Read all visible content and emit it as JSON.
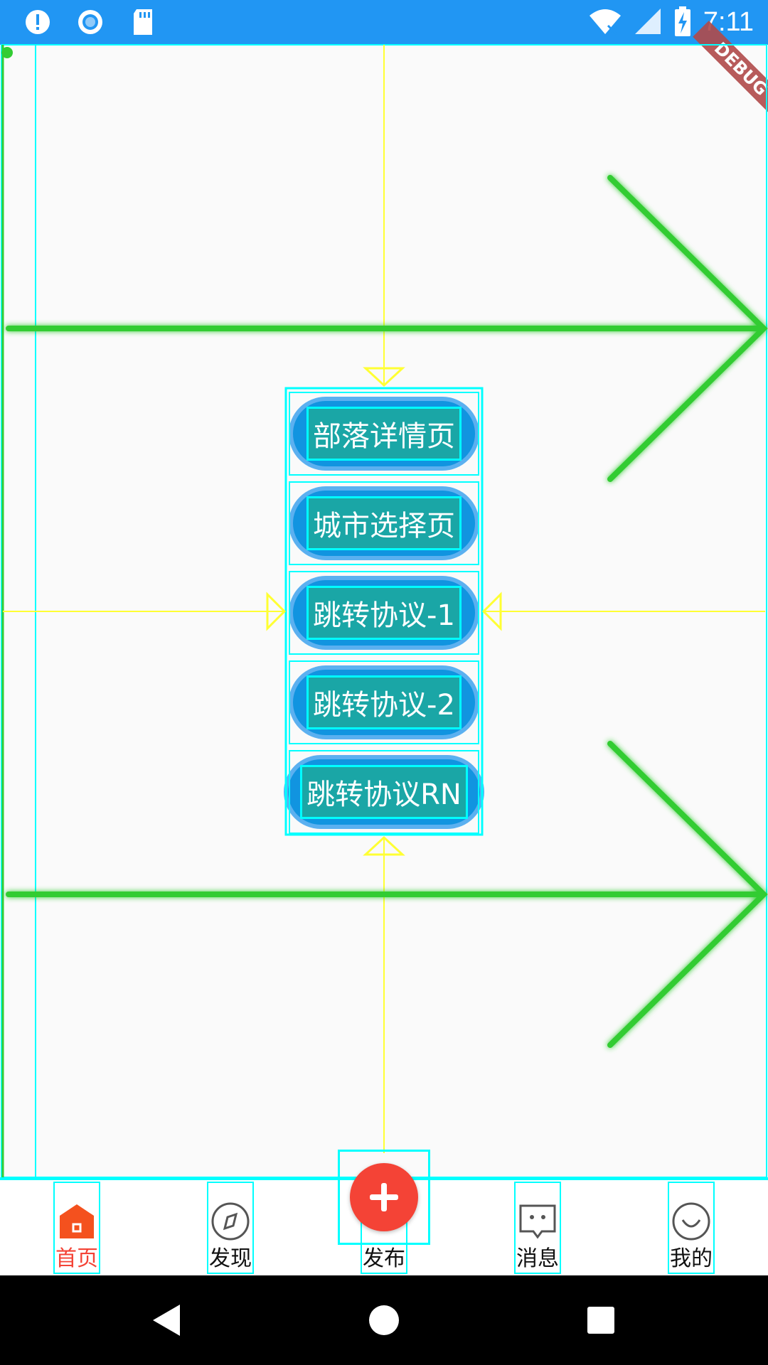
{
  "status_bar": {
    "time": "7:11",
    "left_icons": [
      "alert-icon",
      "sync-icon",
      "sd-card-icon"
    ],
    "right_icons": [
      "wifi-icon",
      "signal-icon",
      "battery-charging-icon"
    ]
  },
  "debug_banner": "DEBUG",
  "buttons": [
    {
      "label": "部落详情页"
    },
    {
      "label": "城市选择页"
    },
    {
      "label": "跳转协议-1"
    },
    {
      "label": "跳转协议-2"
    },
    {
      "label": "跳转协议RN"
    }
  ],
  "bottom_nav": {
    "items": [
      {
        "label": "首页",
        "icon": "home-icon",
        "active": true
      },
      {
        "label": "发现",
        "icon": "compass-icon",
        "active": false
      },
      {
        "label": "发布",
        "icon": "plus-icon",
        "active": false
      },
      {
        "label": "消息",
        "icon": "message-icon",
        "active": false
      },
      {
        "label": "我的",
        "icon": "smile-icon",
        "active": false
      }
    ]
  },
  "colors": {
    "status_bar": "#2196f3",
    "accent": "#f44336",
    "button": "#1194e0",
    "debug_outline": "#00ffff",
    "guide_yellow": "#ffff33",
    "arrow_green": "#33cc33"
  },
  "system_nav": [
    "back-icon",
    "home-circle-icon",
    "recents-icon"
  ]
}
